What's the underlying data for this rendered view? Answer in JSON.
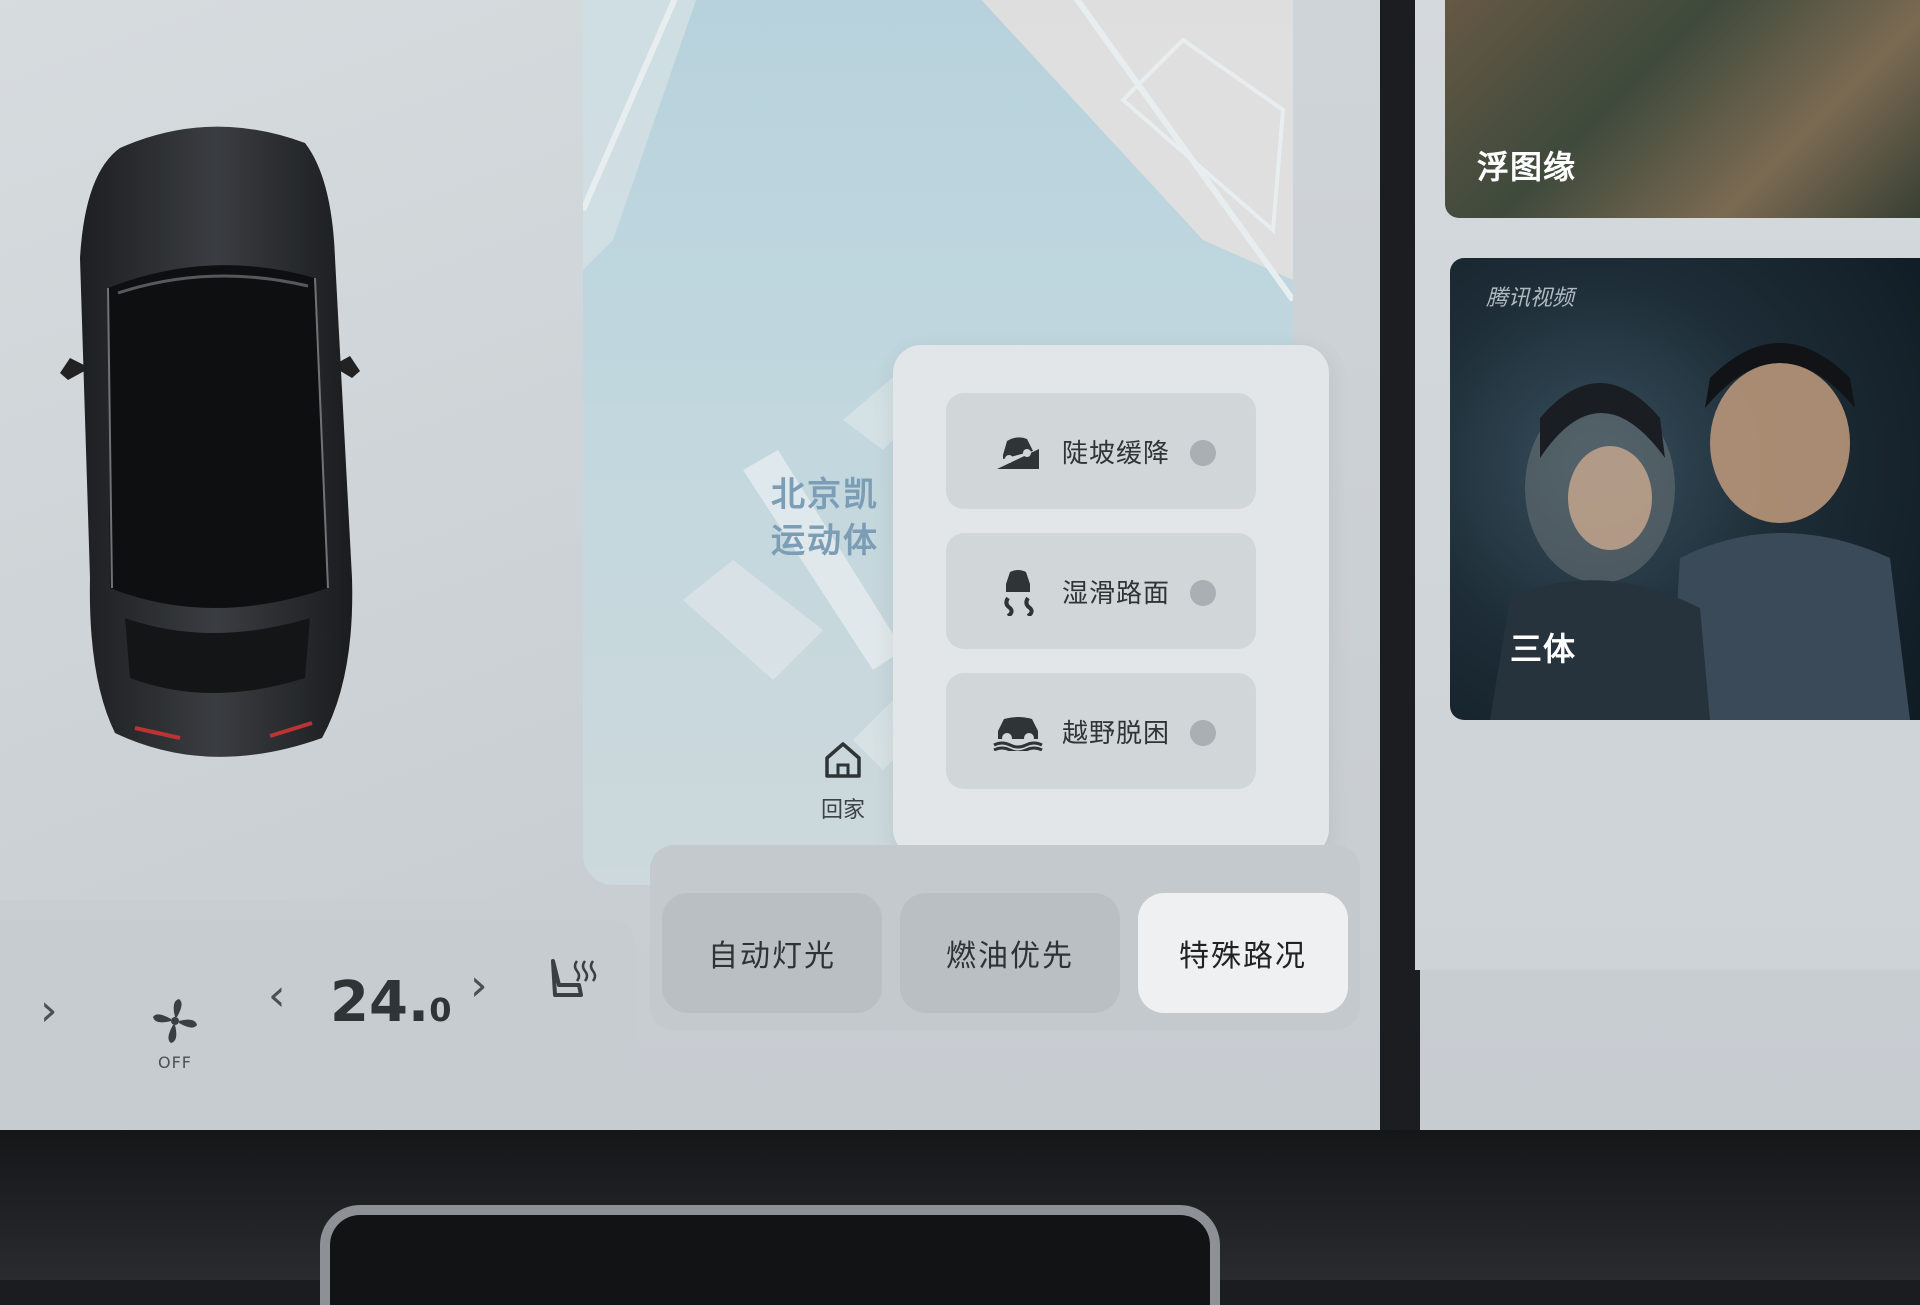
{
  "map": {
    "place_label": "北京凯",
    "place_label_line1": "北京凯",
    "place_label_line2": "运动体",
    "home_label": "回家"
  },
  "road_modes": {
    "items": [
      {
        "label": "陡坡缓降",
        "icon": "hill-descent-icon"
      },
      {
        "label": "湿滑路面",
        "icon": "slippery-road-icon"
      },
      {
        "label": "越野脱困",
        "icon": "offroad-escape-icon"
      }
    ]
  },
  "quick_controls": {
    "auto_light": "自动灯光",
    "fuel_priority": "燃油优先",
    "special_road": "特殊路况"
  },
  "climate": {
    "temp_int": "24.",
    "temp_dec": "0",
    "fan_state": "OFF",
    "left_chevron": "‹",
    "right_chevron": "›"
  },
  "media": {
    "poster1_title": "浮图缘",
    "poster2_brand": "腾讯视频",
    "poster2_title": "三体"
  },
  "colors": {
    "accent_active": "#eef0f1",
    "panel": "#c3c9cd"
  }
}
